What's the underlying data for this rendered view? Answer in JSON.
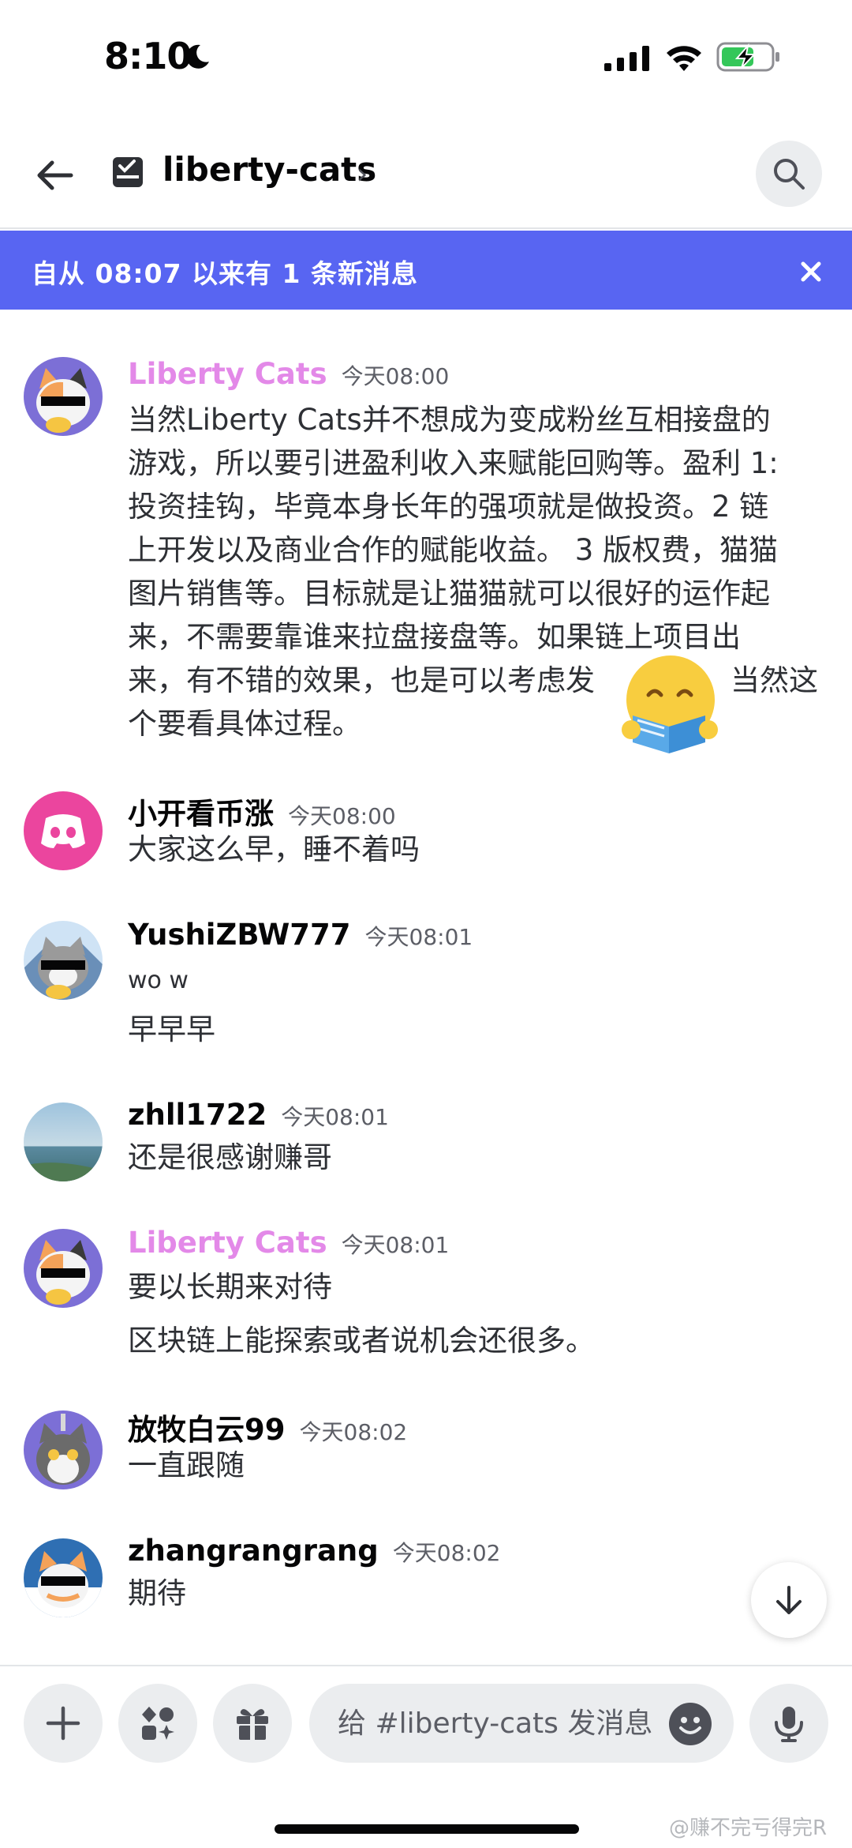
{
  "status_bar": {
    "time": "8:10",
    "battery_color": "#34c759"
  },
  "header": {
    "channel_name": "liberty-cats",
    "chevron": "›"
  },
  "banner": {
    "text": "自从 08:07 以来有 1 条新消息",
    "color": "#5865f2"
  },
  "messages": [
    {
      "author": "Liberty Cats",
      "role_color": "#e389e8",
      "time": "今天08:00",
      "lines": [
        "当然Liberty Cats并不想成为变成粉丝互相接盘的",
        "游戏，所以要引进盈利收入来赋能回购等。盈利 1:",
        "投资挂钩，毕竟本身长年的强项就是做投资。2 链",
        "上开发以及商业合作的赋能收益。 3 版权费，猫猫",
        "图片销售等。目标就是让猫猫就可以很好的运作起",
        "来，不需要靠谁来拉盘接盘等。如果链上项目出",
        "来，有不错的效果，也是可以考虑发",
        "个要看具体过程。"
      ],
      "line7_tail": "当然这"
    },
    {
      "author": "小开看币涨",
      "time": "今天08:00",
      "lines": [
        "大家这么早，睡不着吗"
      ]
    },
    {
      "author": "YushiZBW777",
      "time": "今天08:01",
      "lines": [
        "wo w",
        "早早早"
      ]
    },
    {
      "author": "zhll1722",
      "time": "今天08:01",
      "lines": [
        "还是很感谢赚哥"
      ]
    },
    {
      "author": "Liberty Cats",
      "time": "今天08:01",
      "lines": [
        "要以长期来对待",
        "区块链上能探索或者说机会还很多。"
      ]
    },
    {
      "author": "放牧白云99",
      "time": "今天08:02",
      "lines": [
        "一直跟随"
      ]
    },
    {
      "author": "zhangrangrang",
      "time": "今天08:02",
      "lines": [
        "期待"
      ]
    }
  ],
  "composer": {
    "placeholder": "给 #liberty-cats 发消息"
  },
  "watermark": "@赚不完亏得完R",
  "icons": {
    "back": "arrow-left-icon",
    "channel": "channel-checkbox-icon",
    "search": "search-icon",
    "close": "close-icon",
    "scroll": "arrow-down-icon",
    "plus": "plus-icon",
    "apps": "apps-icon",
    "gift": "gift-icon",
    "emoji": "emoji-icon",
    "mic": "microphone-icon"
  }
}
